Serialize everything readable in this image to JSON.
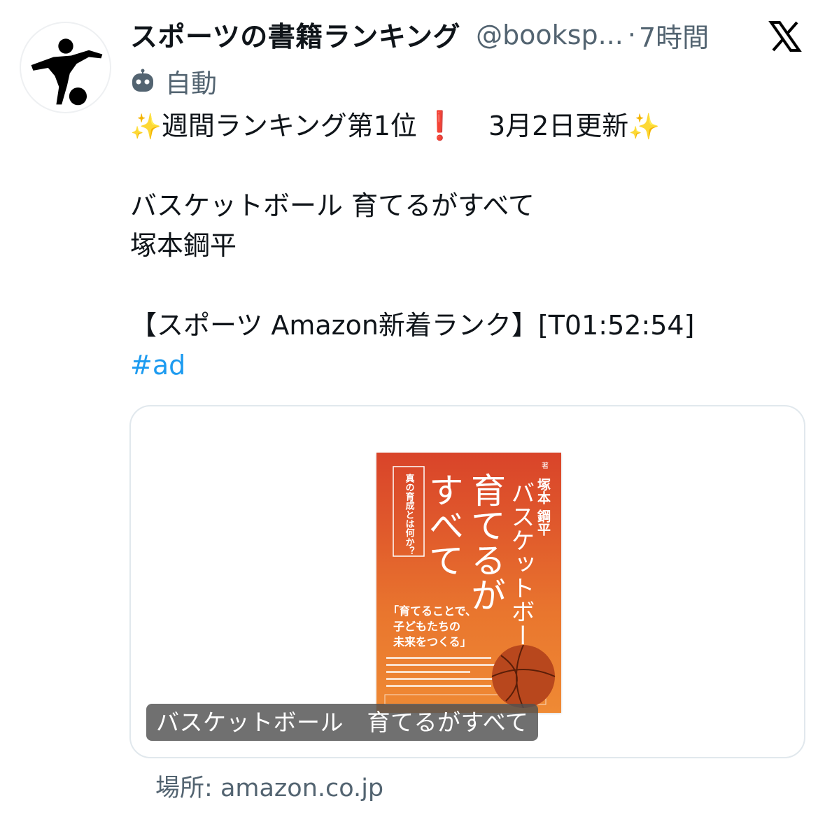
{
  "account": {
    "display_name": "スポーツの書籍ランキング",
    "handle": "@booksp...",
    "separator": "·",
    "time": "7時間",
    "automated_label": "自動"
  },
  "icons": {
    "avatar": "soccer-player-silhouette",
    "platform": "x-logo",
    "automated": "robot-icon"
  },
  "tweet": {
    "line1": {
      "sparkle_left": "✨",
      "text_a": "週間ランキング第1位",
      "exclaim": "❗",
      "text_b": "3月2日更新",
      "sparkle_right": "✨"
    },
    "title": "バスケットボール 育てるがすべて",
    "author": "塚本鋼平",
    "tag_line": "【スポーツ Amazon新着ランク】[T01:52:54]",
    "hashtag": "#ad"
  },
  "card": {
    "caption": "バスケットボール　育てるがすべて",
    "source_label": "場所:",
    "source_domain": "amazon.co.jp",
    "cover": {
      "mark": "著",
      "author": "塚本 鋼平",
      "subtitle_vertical": "バスケットボール",
      "title_line1": "育てるが",
      "title_line2": "すべて",
      "side_box": "真の育成とは何か？",
      "quote_line1": "「育てることで、",
      "quote_line2": "子どもたちの",
      "quote_line3": "未来をつくる」"
    },
    "colors": {
      "cover_top": "#d9442a",
      "cover_bottom": "#ef8a34"
    }
  },
  "colors": {
    "link": "#1d9bf0",
    "secondary_text": "#536471",
    "primary_text": "#0f1419"
  }
}
